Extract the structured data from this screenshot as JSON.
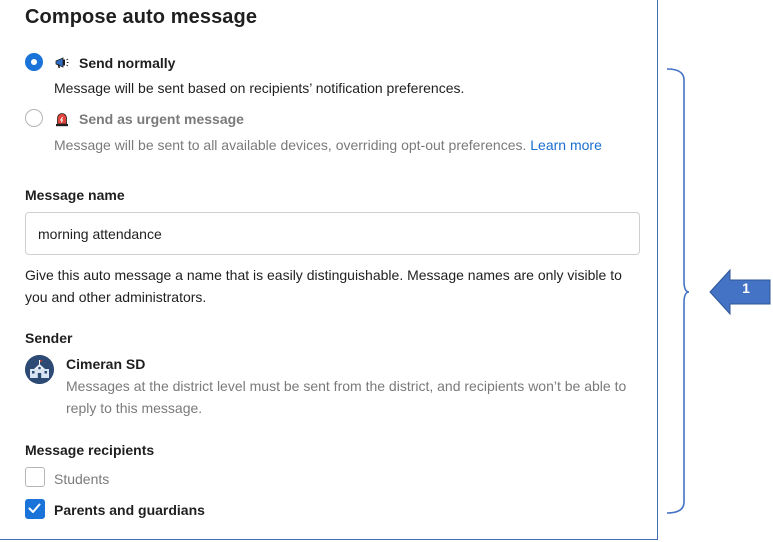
{
  "title": "Compose auto message",
  "delivery": {
    "normal": {
      "label": "Send normally",
      "description": "Message will be sent based on recipients’ notification preferences.",
      "selected": true,
      "icon": "megaphone-icon"
    },
    "urgent": {
      "label": "Send as urgent message",
      "description": "Message will be sent to all available devices, overriding opt-out preferences.",
      "link": "Learn more",
      "selected": false,
      "icon": "siren-icon"
    }
  },
  "message_name": {
    "label": "Message name",
    "value": "morning attendance",
    "help": "Give this auto message a name that is easily distinguishable. Message names are only visible to you and other administrators."
  },
  "sender": {
    "label": "Sender",
    "name": "Cimeran SD",
    "description": "Messages at the district level must be sent from the district, and recipients won’t be able to reply to this message.",
    "icon": "school-building-icon"
  },
  "recipients": {
    "label": "Message recipients",
    "options": [
      {
        "label": "Students",
        "checked": false
      },
      {
        "label": "Parents and guardians",
        "checked": true
      }
    ]
  },
  "annotation": {
    "number": "1"
  },
  "colors": {
    "accent": "#1a73d9",
    "annotation": "#4472c4",
    "muted": "#7a7a7a"
  }
}
